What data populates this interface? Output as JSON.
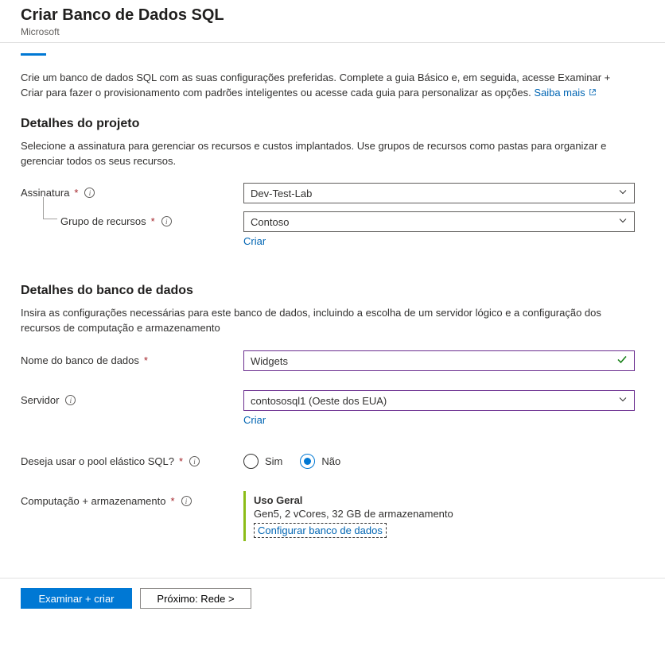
{
  "header": {
    "title": "Criar Banco de Dados SQL",
    "subtitle": "Microsoft"
  },
  "intro": {
    "text": "Crie um banco de dados SQL com as suas configurações preferidas. Complete a guia Básico e, em seguida, acesse Examinar + Criar para fazer o provisionamento com padrões inteligentes ou acesse cada guia para personalizar as opções. ",
    "learn_more": "Saiba mais"
  },
  "project": {
    "heading": "Detalhes do projeto",
    "desc": "Selecione a assinatura para gerenciar os recursos e custos implantados. Use grupos de recursos como pastas para organizar e gerenciar todos os seus recursos.",
    "subscription_label": "Assinatura",
    "subscription_value": "Dev-Test-Lab",
    "resource_group_label": "Grupo de recursos",
    "resource_group_value": "Contoso",
    "create_link": "Criar"
  },
  "database": {
    "heading": "Detalhes do banco de dados",
    "desc": "Insira as configurações necessárias para este banco de dados, incluindo a escolha de um servidor lógico e a configuração dos recursos de computação e armazenamento",
    "db_name_label": "Nome do banco de dados",
    "db_name_value": "Widgets",
    "server_label": "Servidor",
    "server_value": "contososql1 (Oeste dos EUA)",
    "create_link": "Criar",
    "elastic_pool_label": "Deseja usar o pool elástico SQL?",
    "elastic_yes": "Sim",
    "elastic_no": "Não",
    "compute_label": "Computação + armazenamento",
    "compute_tier": "Uso Geral",
    "compute_spec": "Gen5, 2 vCores, 32 GB de armazenamento",
    "configure_link": "Configurar banco de dados"
  },
  "footer": {
    "primary": "Examinar + criar",
    "next": "Próximo: Rede >"
  }
}
